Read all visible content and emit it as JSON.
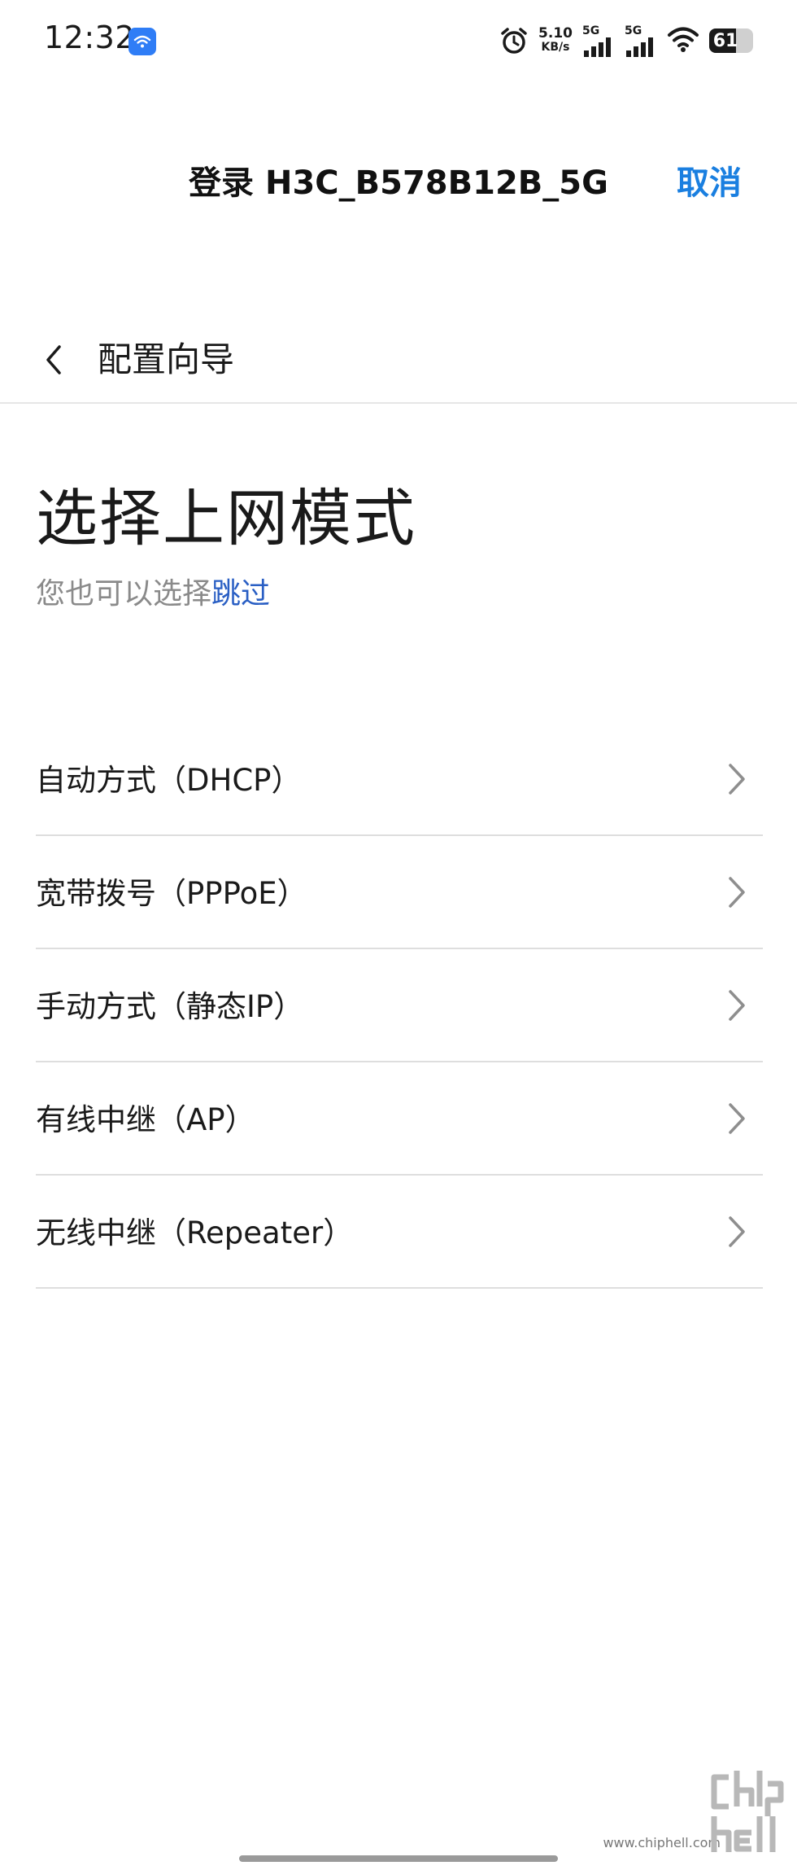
{
  "status_bar": {
    "time": "12:32",
    "net_speed_value": "5.10",
    "net_speed_unit": "KB/s",
    "sim1_label": "5G",
    "sim2_label": "5G",
    "battery_level": "61"
  },
  "login_header": {
    "title": "登录 H3C_B578B12B_5G",
    "cancel_label": "取消"
  },
  "nav": {
    "title": "配置向导"
  },
  "main": {
    "title": "选择上网模式",
    "subtitle_prefix": "您也可以选择",
    "skip_link": "跳过"
  },
  "options": [
    {
      "label": "自动方式（DHCP）"
    },
    {
      "label": "宽带拨号（PPPoE）"
    },
    {
      "label": "手动方式（静态IP）"
    },
    {
      "label": "有线中继（AP）"
    },
    {
      "label": "无线中继（Repeater）"
    }
  ],
  "watermark": {
    "text": "www.chiphell.com",
    "logo_text": "chiphell"
  },
  "colors": {
    "accent": "#1a7fe0",
    "link": "#2a5fc4",
    "secondary_text": "#8a8a8a",
    "divider": "#dedede"
  },
  "icons": {
    "back": "chevron-left-icon",
    "option_arrow": "chevron-right-icon",
    "alarm": "alarm-clock-icon",
    "wifi": "wifi-icon",
    "app": "wifi-app-icon"
  }
}
